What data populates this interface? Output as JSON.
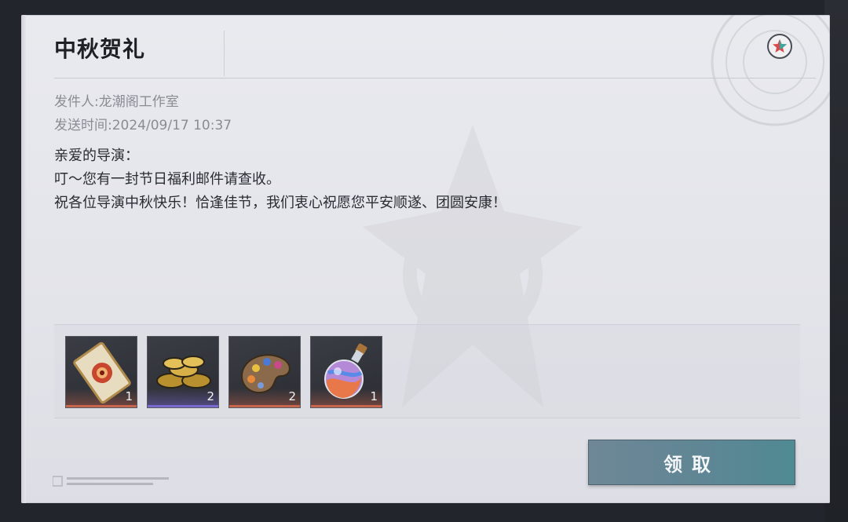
{
  "mail": {
    "title": "中秋贺礼",
    "sender": "发件人:龙潮阁工作室",
    "sent_time": "发送时间:2024/09/17 10:37",
    "body": [
      "亲爱的导演：",
      "叮～您有一封节日福利邮件请查收。",
      "祝各位导演中秋快乐！恰逢佳节，我们衷心祝愿您平安顺遂、团圆安康！"
    ]
  },
  "attachments": [
    {
      "icon": "ticket-icon",
      "count": "1",
      "rarity_color": "#c8654e"
    },
    {
      "icon": "coins-icon",
      "count": "2",
      "rarity_color": "#7a6ad0"
    },
    {
      "icon": "palette-icon",
      "count": "2",
      "rarity_color": "#c8654e"
    },
    {
      "icon": "potion-icon",
      "count": "1",
      "rarity_color": "#c8654e"
    }
  ],
  "actions": {
    "claim_label": "领取"
  },
  "colors": {
    "card_bg": "#e6e7ec",
    "claim_button": "#5f8694",
    "title_text": "#1e2026"
  }
}
